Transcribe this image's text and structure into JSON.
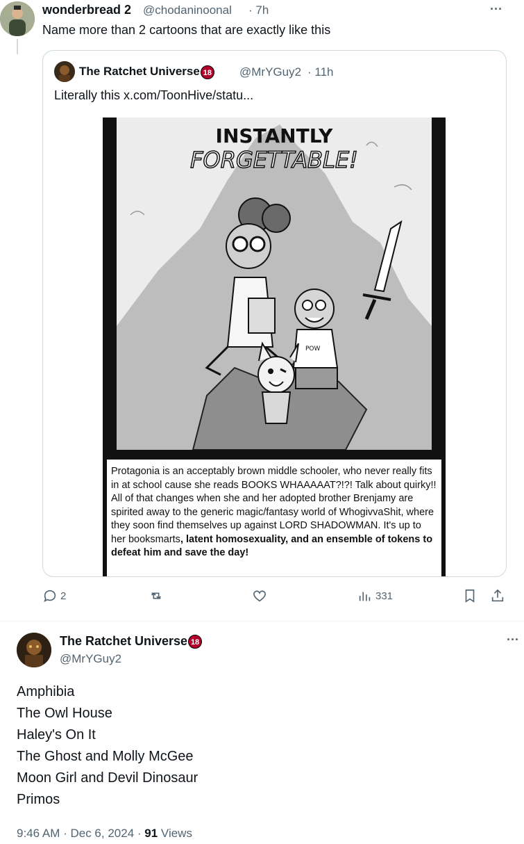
{
  "tweet": {
    "author_name": "wonderbread 2",
    "author_handle": "@chodaninoonal",
    "time": "· 7h",
    "more": "···",
    "text": "Name more than 2 cartoons that are exactly like this"
  },
  "quote": {
    "author_name": "The Ratchet Universe",
    "badge": "18",
    "author_handle": "@MrYGuy2",
    "time": "· 11h",
    "text": "Literally this  x.com/ToonHive/statu...",
    "image": {
      "title_line1": "INSTANTLY",
      "title_line2": "FORGETTABLE!",
      "shirt_text": "POW",
      "caption_plain": "Protagonia is an acceptably brown middle schooler, who never really fits in at school cause she reads BOOKS WHAAAAAT?!?! Talk about quirky!! All of that changes when she and her adopted brother Brenjamy are spirited away to the generic magic/fantasy world of WhogivvaShit, where they soon find themselves up against LORD SHADOWMAN.  It's up to her booksmarts",
      "caption_bold": ", latent homosexuality, and an ensemble of tokens to defeat him and save the day!"
    }
  },
  "actions": {
    "replies": "2",
    "retweets": "",
    "likes": "",
    "views": "331"
  },
  "reply": {
    "author_name": "The Ratchet Universe",
    "badge": "18",
    "author_handle": "@MrYGuy2",
    "more": "···",
    "lines": [
      "Amphibia",
      "The Owl House",
      "Haley's On It",
      "The Ghost and Molly McGee",
      "Moon Girl and Devil Dinosaur",
      "Primos"
    ],
    "timestamp": "9:46 AM · Dec 6, 2024 · ",
    "views_count": "91",
    "views_label": " Views"
  }
}
